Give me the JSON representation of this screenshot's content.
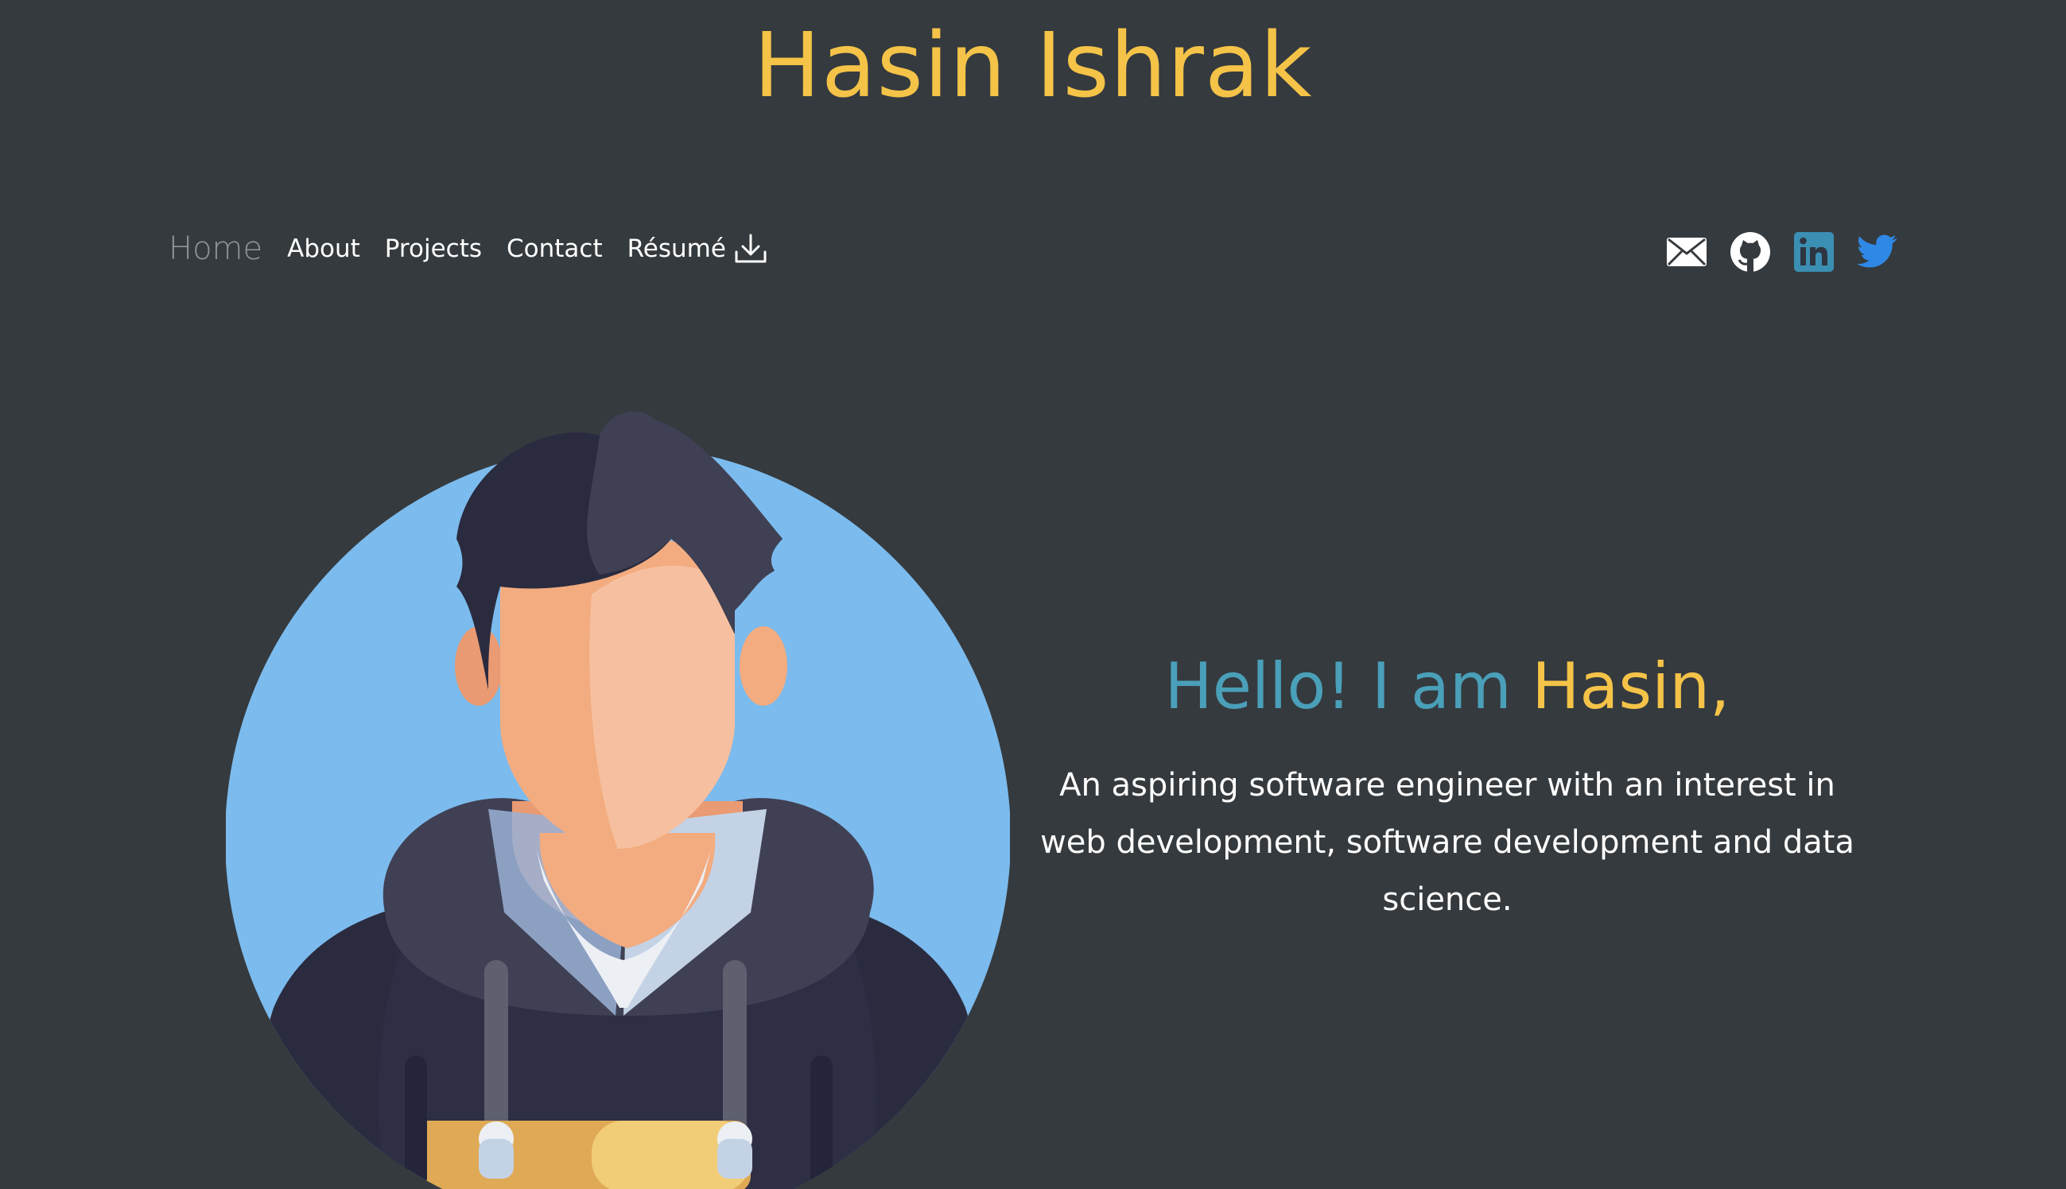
{
  "header": {
    "title": "Hasin Ishrak"
  },
  "nav": {
    "home": "Home",
    "about": "About",
    "projects": "Projects",
    "contact": "Contact",
    "resume": "Résumé"
  },
  "social": {
    "icons": [
      "envelope-icon",
      "github-icon",
      "linkedin-icon",
      "twitter-icon"
    ],
    "colors": {
      "email": "#ffffff",
      "github": "#ffffff",
      "linkedin": "#3b8fb3",
      "twitter": "#2f88e5"
    }
  },
  "hero": {
    "greeting_pre": "Hello! I am",
    "greeting_name": "Hasin,",
    "tagline": "An aspiring software engineer with an interest in web development, software development and data science."
  },
  "colors": {
    "background": "#353a3e",
    "accent": "#f4c348",
    "teal": "#4a9fb9",
    "avatar_bg": "#7cbbed"
  }
}
